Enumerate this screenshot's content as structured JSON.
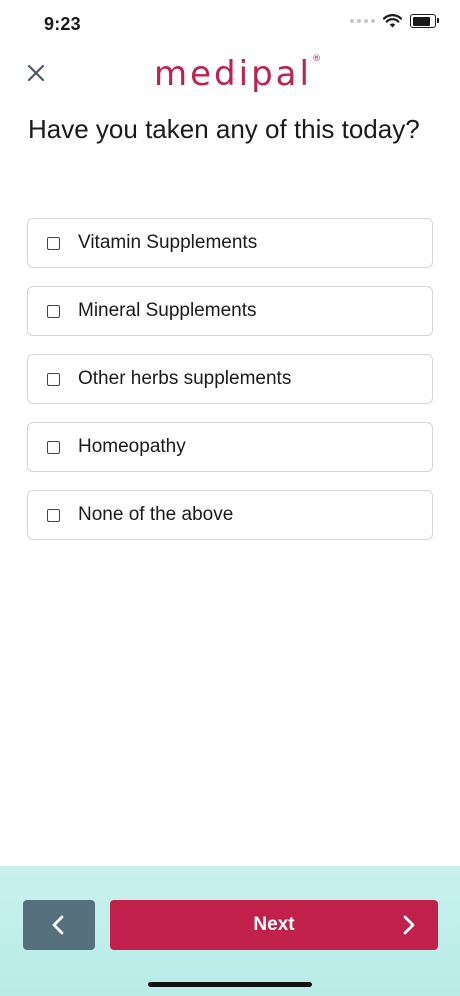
{
  "status_bar": {
    "time": "9:23",
    "battery_level": 0.85
  },
  "header": {
    "logo_text": "medipal",
    "logo_mark": "®"
  },
  "question": {
    "text": "Have you taken any of this today?"
  },
  "options": [
    {
      "label": "Vitamin Supplements",
      "checked": false
    },
    {
      "label": "Mineral Supplements",
      "checked": false
    },
    {
      "label": "Other herbs supplements",
      "checked": false
    },
    {
      "label": "Homeopathy",
      "checked": false
    },
    {
      "label": "None of the above",
      "checked": false
    }
  ],
  "footer": {
    "next_label": "Next"
  },
  "colors": {
    "brand": "#c0204a",
    "back_button": "#56717d",
    "footer_background": "#c9f1ee"
  },
  "icons": {
    "close": "close-icon",
    "back": "chevron-left-icon",
    "next": "chevron-right-icon",
    "wifi": "wifi-icon",
    "battery": "battery-icon",
    "checkbox": "checkbox-icon"
  }
}
